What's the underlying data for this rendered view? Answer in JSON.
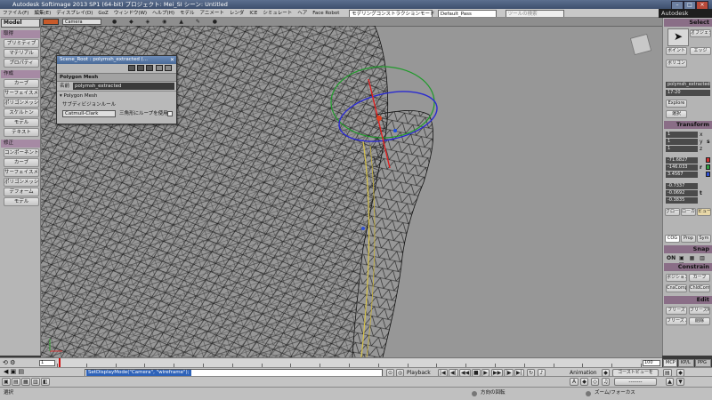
{
  "window": {
    "title": "Autodesk Softimage 2013 SP1 (64-bit)    プロジェクト: Mei_SI    シーン: Untitled",
    "brand": "Autodesk Softimage"
  },
  "menu": {
    "items": [
      "ファイル(F)",
      "編集(E)",
      "ディスプレイ(D)",
      "GoZ",
      "ウィンドウ(W)",
      "ヘルプ(H)",
      "モデル",
      "アニメート",
      "レンダ",
      "ICE",
      "シミュレート",
      "ヘア",
      "Face Robot"
    ],
    "layout_select": "モデリングコンストラクションモード",
    "pass_select": "Default_Pass",
    "search_placeholder": "ツールの検索"
  },
  "left_panel": {
    "mode": "Model",
    "sections": [
      {
        "title": "取得",
        "buttons": [
          "プリミティブ",
          "マテリアル",
          "プロパティ"
        ]
      },
      {
        "title": "作成",
        "buttons": [
          "カーブ",
          "サーフェイスメッシュ",
          "ポリゴンメッシュ",
          "スケルトン",
          "モデル",
          "テキスト"
        ]
      },
      {
        "title": "修正",
        "buttons": [
          "コンポーネント",
          "カーブ",
          "サーフェイスメッシュ",
          "ポリゴンメッシュ",
          "デフォーム",
          "モデル"
        ]
      }
    ]
  },
  "viewport": {
    "camera": "Camera"
  },
  "dialog": {
    "title": "Scene_Root : polymsh_extracted (...",
    "section": "Polygon Mesh",
    "name_label": "名前",
    "name_value": "polymsh_extracted",
    "sub_section": "▾ Polygon Mesh",
    "subdiv_label": "サブディビジョンルール",
    "subdiv_value": "Catmull-Clark",
    "checkbox_label": "三角形にループを使用"
  },
  "right_panel": {
    "select_header": "Select",
    "select_buttons": [
      "オブジェクト",
      "ポイント",
      "エッジ",
      "ポリゴン"
    ],
    "selection_name": "polymsh_extracted",
    "range": "17-20",
    "transform_header": "Transform",
    "transform_rows": [
      {
        "label": "s",
        "values": [
          "1",
          "1",
          "1"
        ]
      },
      {
        "label": "r",
        "values": [
          "-71.6827",
          "-146.033",
          "3.4567"
        ]
      },
      {
        "label": "t",
        "values": [
          "-0.7337",
          "-0.0692",
          "-0.3835"
        ]
      }
    ],
    "axes": [
      "x",
      "y",
      "z"
    ],
    "ref_buttons": [
      "グローバル",
      "ローカル",
      "ビュー"
    ],
    "snap_header": "Snap",
    "snap_state": "ON",
    "constrain_header": "Constrain",
    "edit_header": "Edit",
    "edit_buttons": [
      "フリーズ",
      "フリーズM",
      "フリーズ All",
      "削除"
    ]
  },
  "timeline": {
    "start": "1",
    "end": "100",
    "current_frame_fraction": 0.003
  },
  "bottom": {
    "command": "SetDisplayMode(\"Camera\", \"wireframe\");",
    "playback_label": "Playback",
    "animation_label": "Animation",
    "tabs": [
      "MCP",
      "KP/L",
      "PPG"
    ],
    "status_left": "選択",
    "status_middle": "方向の回転",
    "status_right": "ズーム/フォーカス"
  }
}
